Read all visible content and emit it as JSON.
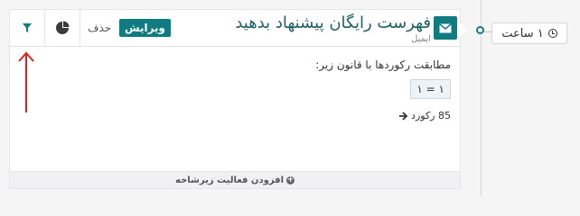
{
  "trigger": {
    "label": "۱ ساعت",
    "icon": "clock-icon"
  },
  "card": {
    "title": "فهرست رایگان پیشنهاد بدهید",
    "subtitle": "ایمیل",
    "edit_label": "ویرایش",
    "delete_label": "حذف",
    "condition_text": "مطابقت رکوردها با قانون زیر:",
    "condition_value": "۱ = ۱",
    "records_text": "85 رکورد",
    "footer_label": "افزودن فعالیت زیرشاخه",
    "icons": [
      "mail-icon",
      "filter-icon",
      "pie-chart-icon",
      "arrow-right-icon",
      "plus-circle-icon"
    ]
  },
  "colors": {
    "accent": "#0f7c82",
    "annotation": "#e02020"
  }
}
